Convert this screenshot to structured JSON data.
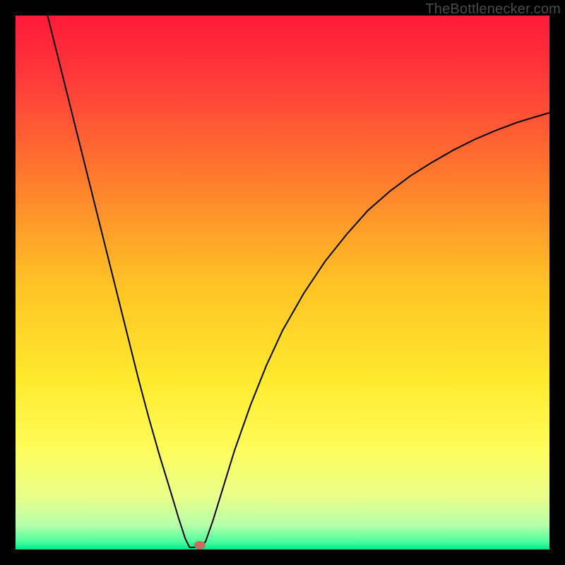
{
  "watermark": "TheBottlenecker.com",
  "chart_data": {
    "type": "line",
    "title": "",
    "xlabel": "",
    "ylabel": "",
    "xlim": [
      0,
      1
    ],
    "ylim": [
      0,
      1
    ],
    "background": {
      "type": "vertical-gradient",
      "stops": [
        {
          "offset": 0.0,
          "color": "#ff1a3a"
        },
        {
          "offset": 0.12,
          "color": "#ff3a3a"
        },
        {
          "offset": 0.3,
          "color": "#ff7a2e"
        },
        {
          "offset": 0.5,
          "color": "#ffc225"
        },
        {
          "offset": 0.68,
          "color": "#ffe92e"
        },
        {
          "offset": 0.8,
          "color": "#fffb55"
        },
        {
          "offset": 0.9,
          "color": "#eaff8a"
        },
        {
          "offset": 0.955,
          "color": "#b6ffaa"
        },
        {
          "offset": 0.985,
          "color": "#4cff9f"
        },
        {
          "offset": 1.0,
          "color": "#00e88b"
        }
      ]
    },
    "series": [
      {
        "name": "bottleneck-curve",
        "color": "#000000",
        "stroke_width": 2,
        "points": [
          {
            "x": 0.06,
            "y": 1.0
          },
          {
            "x": 0.075,
            "y": 0.94
          },
          {
            "x": 0.09,
            "y": 0.88
          },
          {
            "x": 0.11,
            "y": 0.8
          },
          {
            "x": 0.13,
            "y": 0.72
          },
          {
            "x": 0.15,
            "y": 0.64
          },
          {
            "x": 0.17,
            "y": 0.56
          },
          {
            "x": 0.19,
            "y": 0.48
          },
          {
            "x": 0.21,
            "y": 0.4
          },
          {
            "x": 0.23,
            "y": 0.32
          },
          {
            "x": 0.25,
            "y": 0.245
          },
          {
            "x": 0.27,
            "y": 0.175
          },
          {
            "x": 0.29,
            "y": 0.11
          },
          {
            "x": 0.305,
            "y": 0.06
          },
          {
            "x": 0.318,
            "y": 0.02
          },
          {
            "x": 0.326,
            "y": 0.004
          },
          {
            "x": 0.336,
            "y": 0.004
          },
          {
            "x": 0.345,
            "y": 0.004
          },
          {
            "x": 0.356,
            "y": 0.015
          },
          {
            "x": 0.37,
            "y": 0.055
          },
          {
            "x": 0.39,
            "y": 0.12
          },
          {
            "x": 0.41,
            "y": 0.185
          },
          {
            "x": 0.44,
            "y": 0.27
          },
          {
            "x": 0.47,
            "y": 0.345
          },
          {
            "x": 0.5,
            "y": 0.41
          },
          {
            "x": 0.54,
            "y": 0.48
          },
          {
            "x": 0.58,
            "y": 0.54
          },
          {
            "x": 0.62,
            "y": 0.59
          },
          {
            "x": 0.66,
            "y": 0.635
          },
          {
            "x": 0.7,
            "y": 0.67
          },
          {
            "x": 0.74,
            "y": 0.7
          },
          {
            "x": 0.78,
            "y": 0.725
          },
          {
            "x": 0.82,
            "y": 0.748
          },
          {
            "x": 0.86,
            "y": 0.768
          },
          {
            "x": 0.9,
            "y": 0.785
          },
          {
            "x": 0.94,
            "y": 0.8
          },
          {
            "x": 0.98,
            "y": 0.812
          },
          {
            "x": 1.0,
            "y": 0.818
          }
        ]
      }
    ],
    "marker": {
      "name": "optimal-point",
      "x": 0.345,
      "y": 0.008,
      "rx": 8,
      "ry": 6,
      "fill": "#c96a60"
    }
  }
}
